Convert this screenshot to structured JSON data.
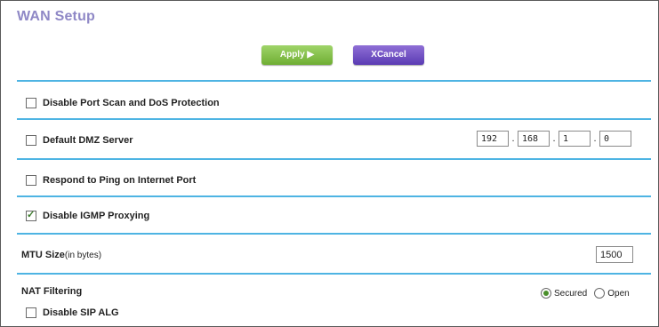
{
  "page": {
    "title": "WAN Setup"
  },
  "toolbar": {
    "apply_label": "Apply",
    "apply_glyph": "▶",
    "cancel_glyph": "X",
    "cancel_label": "Cancel"
  },
  "options": {
    "port_scan": {
      "label": "Disable Port Scan and DoS Protection",
      "checked": false
    },
    "dmz": {
      "label": "Default DMZ Server",
      "checked": false,
      "ip": [
        "192",
        "168",
        "1",
        "0"
      ]
    },
    "ping": {
      "label": "Respond to Ping on Internet Port",
      "checked": false
    },
    "igmp": {
      "label": "Disable IGMP Proxying",
      "checked": true
    },
    "mtu": {
      "label": "MTU Size",
      "unit": "(in bytes)",
      "value": "1500"
    },
    "nat": {
      "label": "NAT Filtering",
      "options": [
        "Secured",
        "Open"
      ],
      "selected": "Secured"
    },
    "sip_alg": {
      "label": "Disable SIP ALG",
      "checked": false
    }
  },
  "colors": {
    "title": "#8f88c6",
    "divider": "#4eb4e3",
    "apply": "#7dbb3f",
    "cancel": "#6a48c2"
  }
}
